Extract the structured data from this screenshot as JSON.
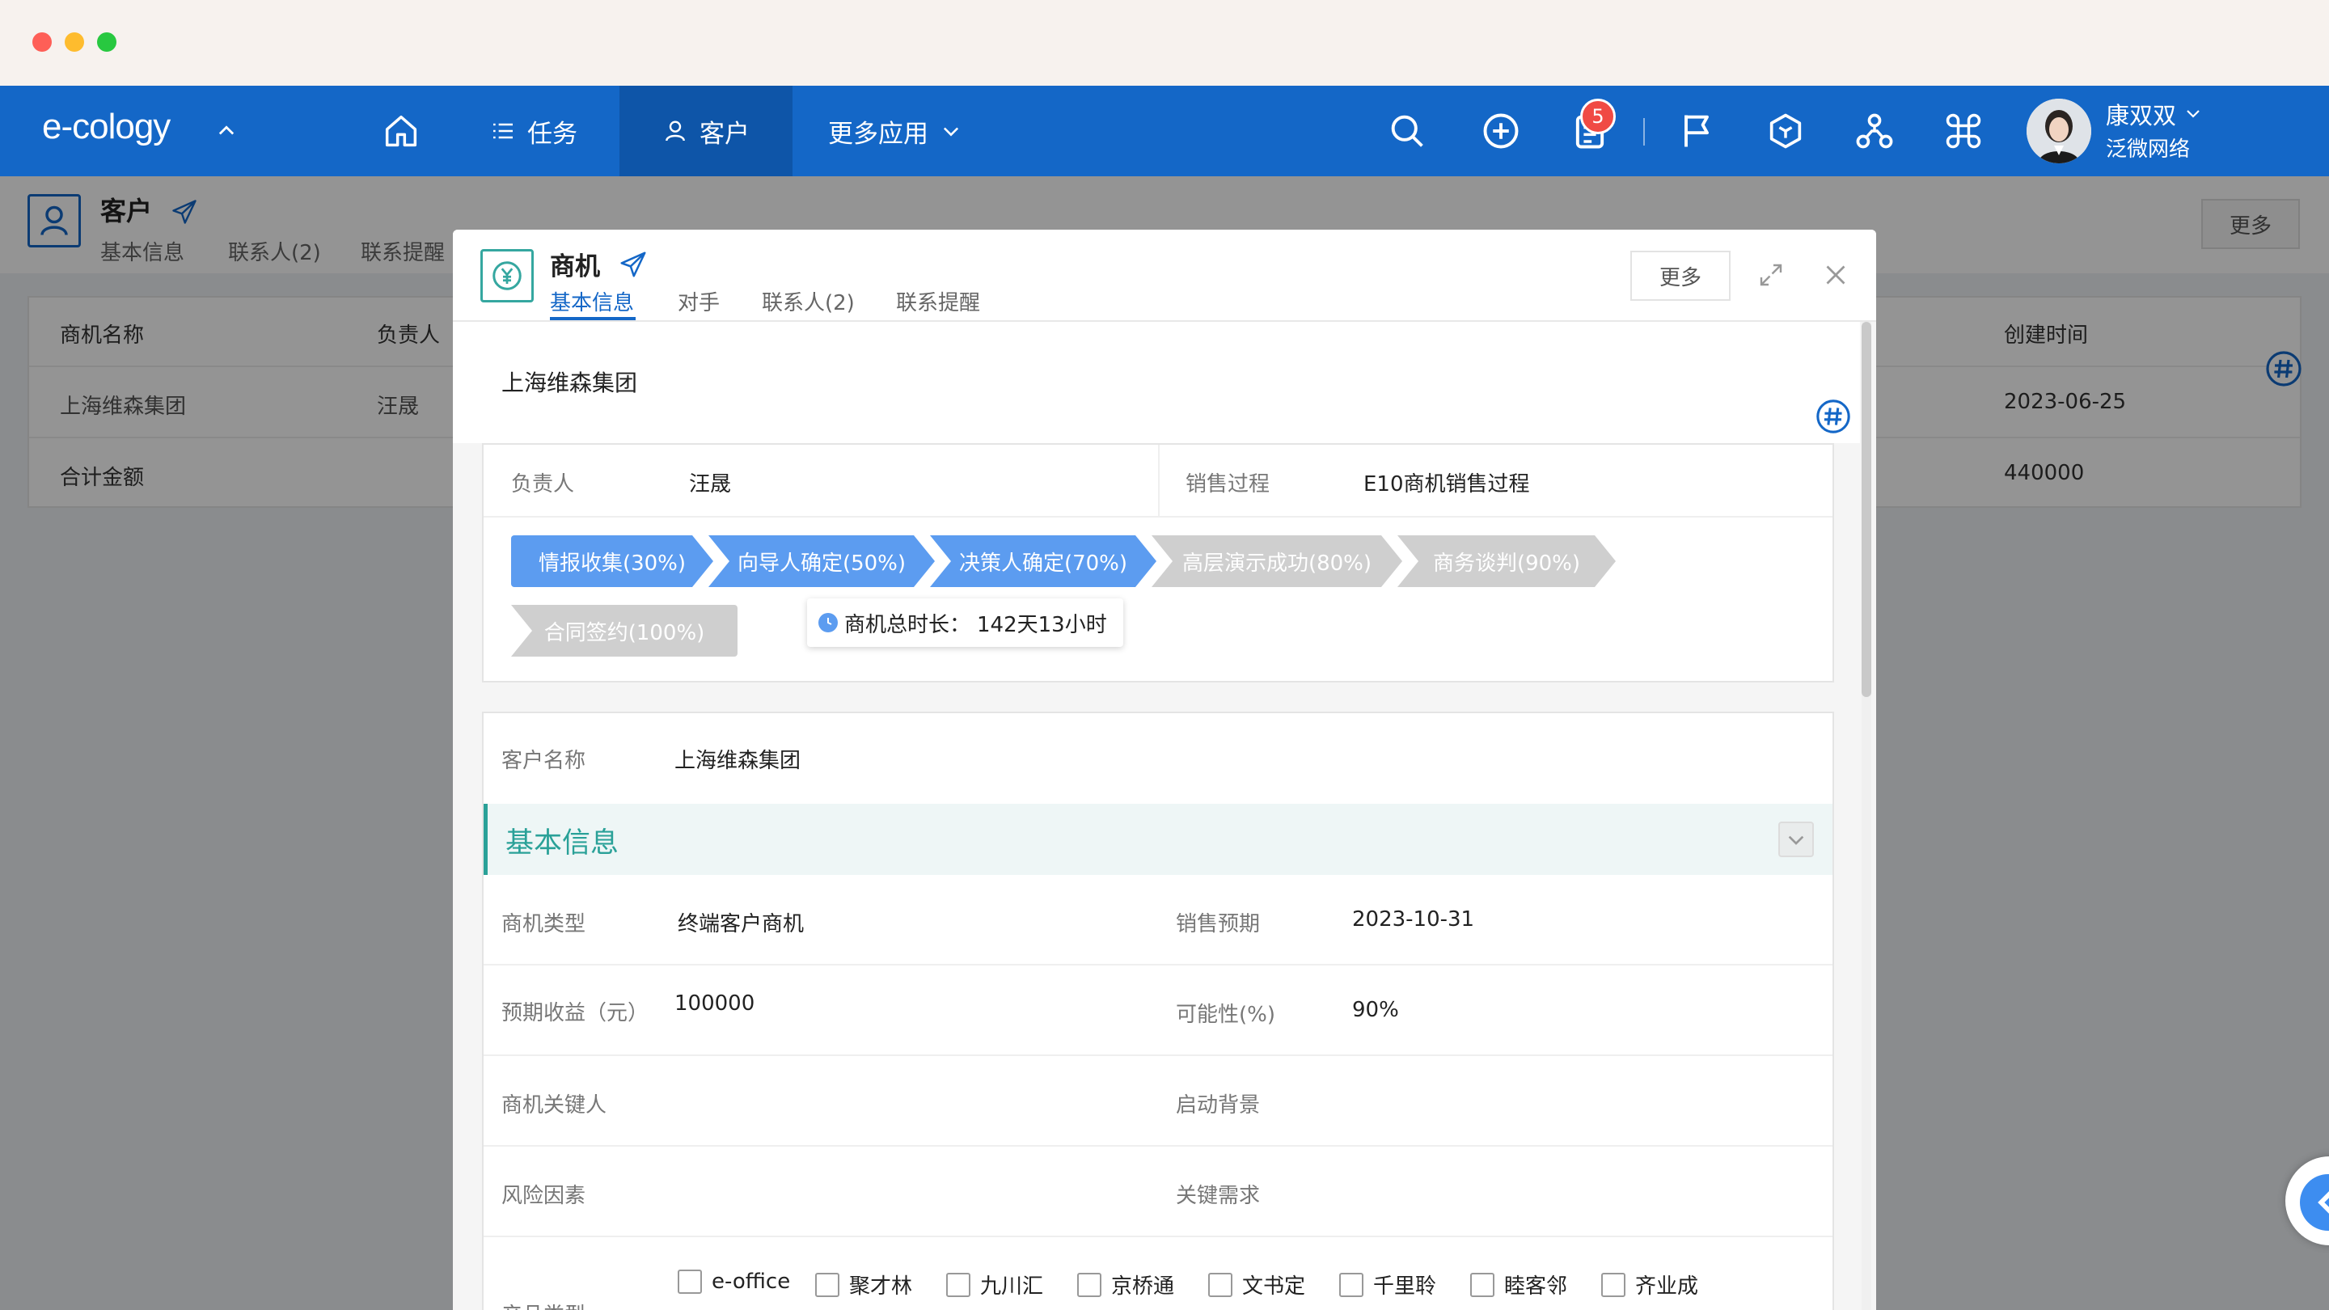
{
  "app": {
    "logo": "e-cology",
    "nav": {
      "tasks": "任务",
      "customer": "客户",
      "more_apps": "更多应用"
    },
    "notification_count": "5",
    "user": {
      "name": "康双双",
      "org": "泛微网络"
    }
  },
  "background_page": {
    "title": "客户",
    "tabs": [
      "基本信息",
      "联系人(2)",
      "联系提醒"
    ],
    "more_button": "更多",
    "table": {
      "headers": {
        "name": "商机名称",
        "owner": "负责人",
        "created": "创建时间"
      },
      "rows": [
        {
          "name": "上海维森集团",
          "owner": "汪晟",
          "created": "2023-06-25"
        }
      ],
      "total_label": "合计金额",
      "total_value": "440000"
    }
  },
  "modal": {
    "title": "商机",
    "tabs": [
      "基本信息",
      "对手",
      "联系人(2)",
      "联系提醒"
    ],
    "active_tab": "基本信息",
    "more_button": "更多",
    "company_name": "上海维森集团",
    "owner_label": "负责人",
    "owner_value": "汪晟",
    "sales_process_label": "销售过程",
    "sales_process_value": "E10商机销售过程",
    "stages": [
      {
        "label": "情报收集(30%)",
        "status": "done"
      },
      {
        "label": "向导人确定(50%)",
        "status": "done"
      },
      {
        "label": "决策人确定(70%)",
        "status": "done"
      },
      {
        "label": "高层演示成功(80%)",
        "status": "todo"
      },
      {
        "label": "商务谈判(90%)",
        "status": "todo"
      },
      {
        "label": "合同签约(100%)",
        "status": "todo"
      }
    ],
    "duration_label": "商机总时长：",
    "duration_value": "142天13小时",
    "customer_name_label": "客户名称",
    "customer_name_value": "上海维森集团",
    "section_title": "基本信息",
    "fields": {
      "type_label": "商机类型",
      "type_value": "终端客户商机",
      "expected_sales_label": "销售预期",
      "expected_sales_value": "2023-10-31",
      "revenue_label": "预期收益（元）",
      "revenue_value": "100000",
      "probability_label": "可能性(%)",
      "probability_value": "90%",
      "key_person_label": "商机关键人",
      "background_label": "启动背景",
      "risk_label": "风险因素",
      "key_needs_label": "关键需求",
      "product_type_label": "产品类型"
    },
    "products": [
      "e-office",
      "聚才林",
      "九川汇",
      "京桥通",
      "文书定",
      "千里聆",
      "睦客邻",
      "齐业成"
    ]
  },
  "colors": {
    "nav_blue": "#1467c7",
    "stage_done": "#5c9cf0",
    "stage_todo": "#cfcfcf",
    "section_teal": "#2aa198"
  }
}
